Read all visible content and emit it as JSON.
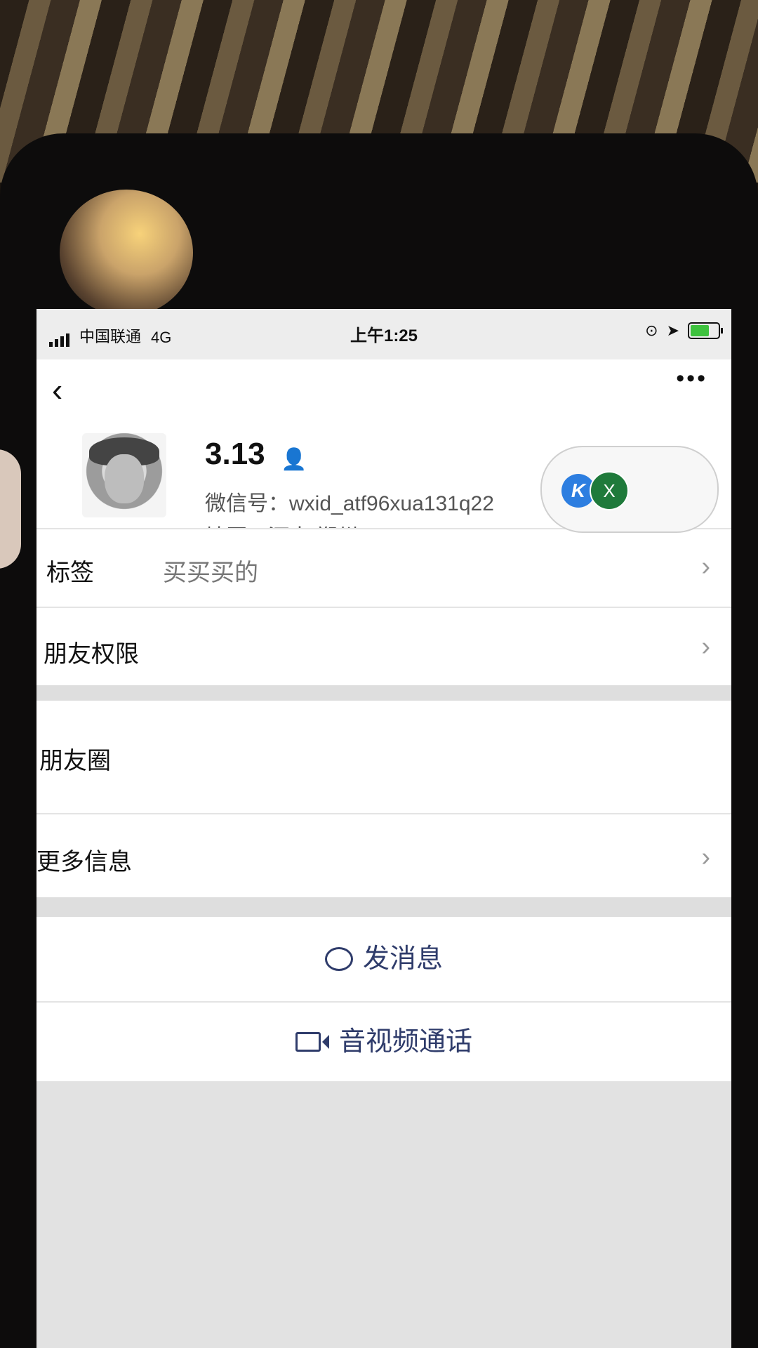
{
  "status_bar": {
    "carrier": "中国联通",
    "network": "4G",
    "time": "上午1:25"
  },
  "profile": {
    "nickname": "3.13",
    "wechat_id": "微信号：wxid_atf96xua131q22",
    "region": "地区：河南 郑州"
  },
  "rows": {
    "tags_label": "标签",
    "tags_value": "买买买的",
    "permissions_label": "朋友权限",
    "moments_label": "朋友圈",
    "more_info_label": "更多信息"
  },
  "actions": {
    "message": "发消息",
    "call": "音视频通话"
  },
  "floating_widget": {
    "k_label": "K",
    "x_label": "X"
  },
  "icons": {
    "back": "chevron-left-icon",
    "more": "ellipsis-icon",
    "contact": "contact-person-icon",
    "chevron": "chevron-right-icon",
    "message": "chat-bubble-icon",
    "call": "video-camera-icon"
  },
  "colors": {
    "action_text": "#2f3c6b",
    "contact_icon": "#2a7bd6",
    "battery": "#3ec23e"
  }
}
